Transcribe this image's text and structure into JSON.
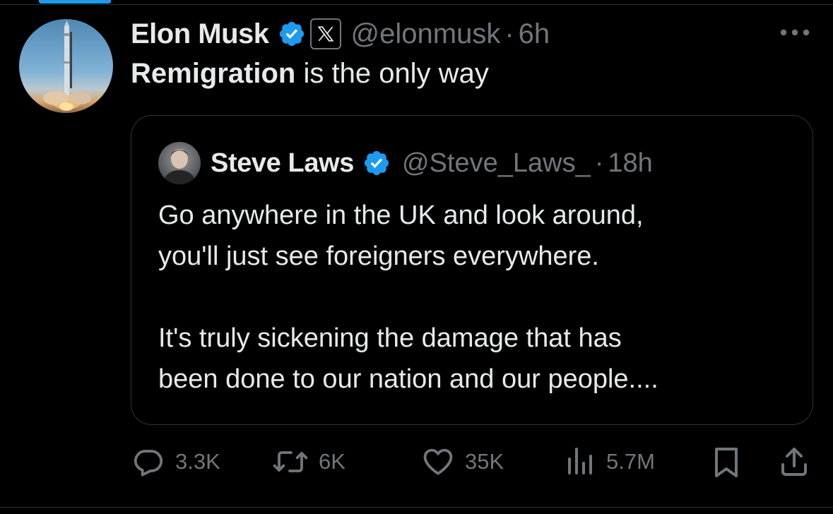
{
  "tweet": {
    "author_name": "Elon Musk",
    "handle": "@elonmusk",
    "separator": "·",
    "time": "6h",
    "text_bold": "Remigration",
    "text_rest": " is the only way"
  },
  "quote": {
    "author_name": "Steve Laws",
    "handle": "@Steve_Laws_",
    "separator": "·",
    "time": "18h",
    "line1": "Go anywhere in the UK and look around,",
    "line2": "you'll just see foreigners everywhere.",
    "line3": "It's truly sickening the damage that has",
    "line4": "been done to our nation and our people...."
  },
  "actions": {
    "replies": "3.3K",
    "reposts": "6K",
    "likes": "35K",
    "views": "5.7M"
  },
  "icons": {
    "verified": "verified-badge-icon",
    "affiliate": "x-logo-icon",
    "more": "more-options-icon",
    "reply": "reply-icon",
    "repost": "repost-icon",
    "like": "heart-icon",
    "views": "views-icon",
    "bookmark": "bookmark-icon",
    "share": "share-icon"
  },
  "colors": {
    "background": "#000000",
    "text": "#e7e9ea",
    "muted": "#71767b",
    "verified": "#1d9bf0",
    "border": "#2f3336"
  }
}
